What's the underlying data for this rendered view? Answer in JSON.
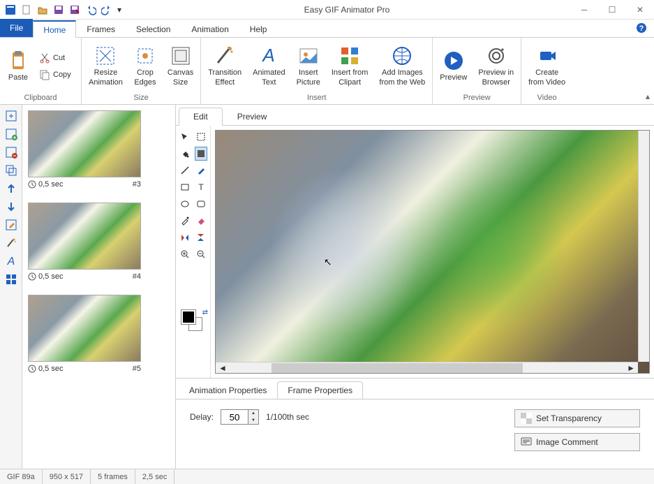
{
  "app": {
    "title": "Easy GIF Animator Pro"
  },
  "menu": {
    "file": "File",
    "tabs": [
      "Home",
      "Frames",
      "Selection",
      "Animation",
      "Help"
    ],
    "active": "Home"
  },
  "ribbon": {
    "clipboard": {
      "paste": "Paste",
      "cut": "Cut",
      "copy": "Copy",
      "label": "Clipboard"
    },
    "size": {
      "resize": "Resize\nAnimation",
      "crop": "Crop\nEdges",
      "canvas": "Canvas\nSize",
      "label": "Size"
    },
    "insert": {
      "transition": "Transition\nEffect",
      "animtext": "Animated\nText",
      "picture": "Insert\nPicture",
      "clipart": "Insert from\nClipart",
      "web": "Add Images\nfrom the Web",
      "label": "Insert"
    },
    "preview": {
      "preview": "Preview",
      "browser": "Preview in\nBrowser",
      "label": "Preview"
    },
    "video": {
      "create": "Create\nfrom Video",
      "label": "Video"
    }
  },
  "frames": [
    {
      "time": "0,5 sec",
      "num": "#3"
    },
    {
      "time": "0,5 sec",
      "num": "#4"
    },
    {
      "time": "0,5 sec",
      "num": "#5"
    }
  ],
  "editor_tabs": {
    "edit": "Edit",
    "preview": "Preview"
  },
  "props": {
    "tabs": {
      "anim": "Animation Properties",
      "frame": "Frame Properties"
    },
    "delay_label": "Delay:",
    "delay_value": "50",
    "delay_unit": "1/100th sec",
    "set_transparency": "Set Transparency",
    "image_comment": "Image Comment"
  },
  "status": {
    "type": "GIF 89a",
    "dims": "950 x 517",
    "frames": "5 frames",
    "duration": "2,5 sec"
  }
}
